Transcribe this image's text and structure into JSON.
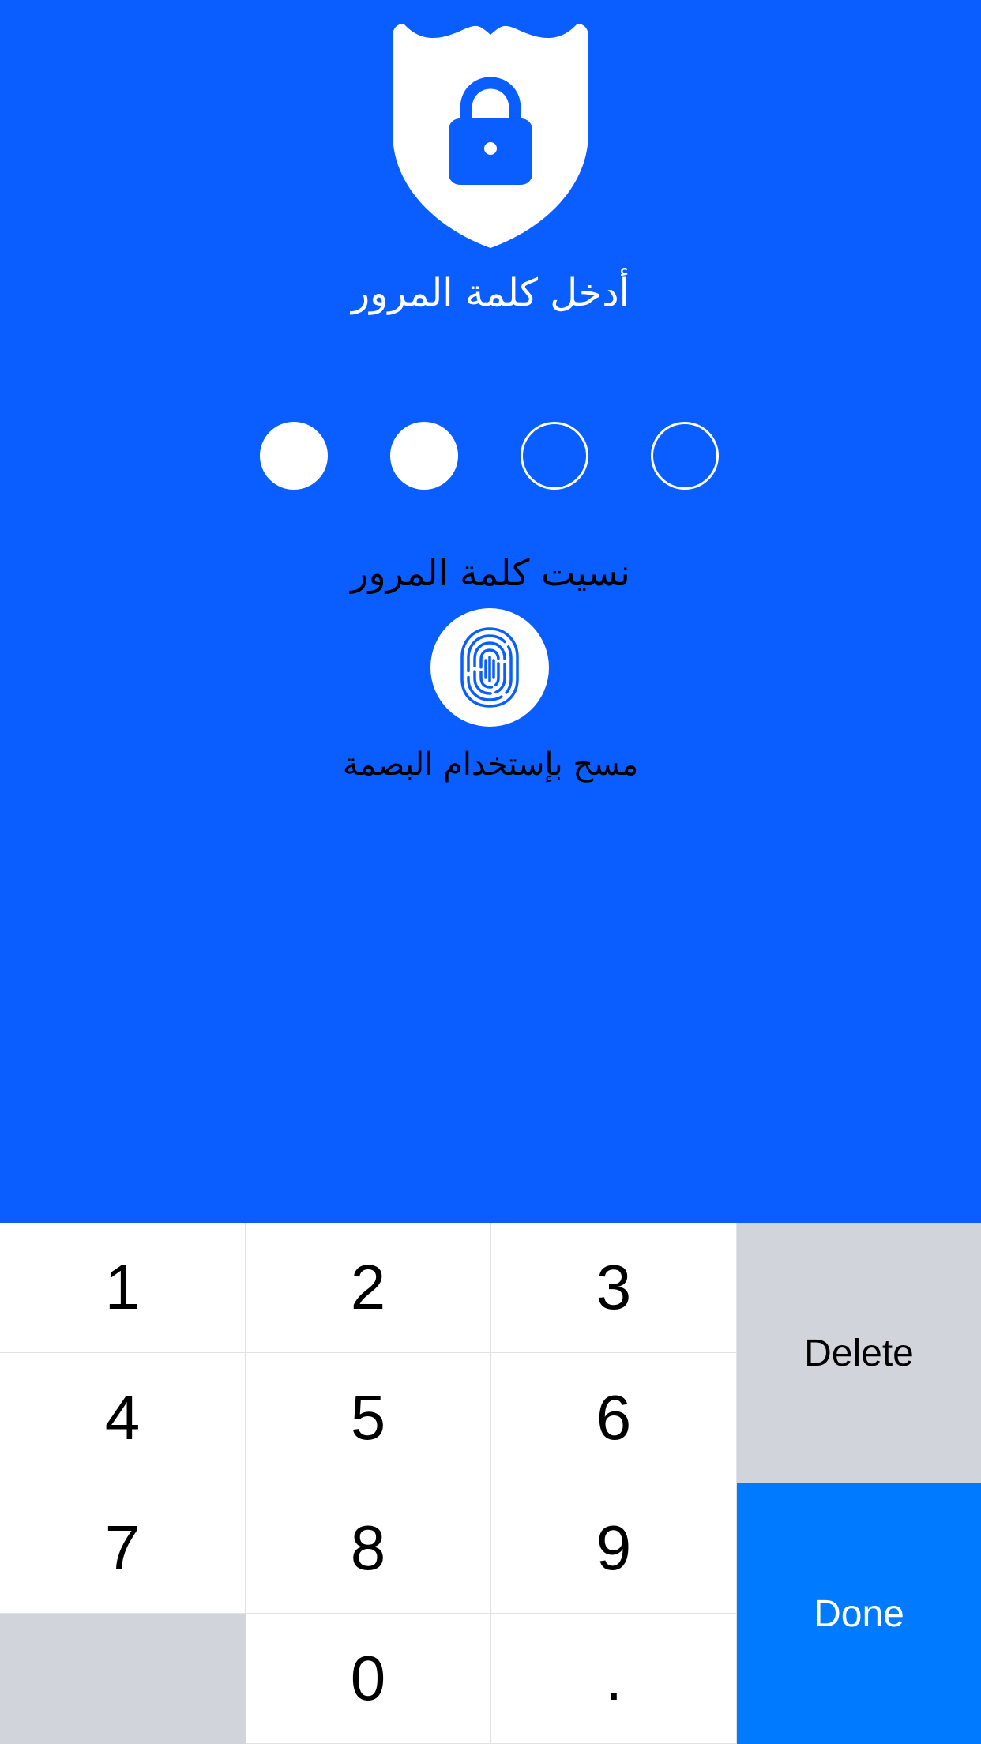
{
  "colors": {
    "background": "#0a5eff",
    "keypad_background": "#ffffff",
    "keypad_gray": "#d1d5db",
    "done_button": "#007aff"
  },
  "lock_screen": {
    "icon": "shield-lock-icon",
    "title": "أدخل كلمة المرور",
    "passcode_length": 4,
    "entered_digits": 2,
    "forgot_label": "نسيت كلمة المرور",
    "fingerprint_icon": "fingerprint-icon",
    "fingerprint_label": "مسح بإستخدام البصمة"
  },
  "keypad": {
    "keys": [
      "1",
      "2",
      "3",
      "4",
      "5",
      "6",
      "7",
      "8",
      "9",
      "0",
      "."
    ],
    "delete_label": "Delete",
    "done_label": "Done"
  }
}
